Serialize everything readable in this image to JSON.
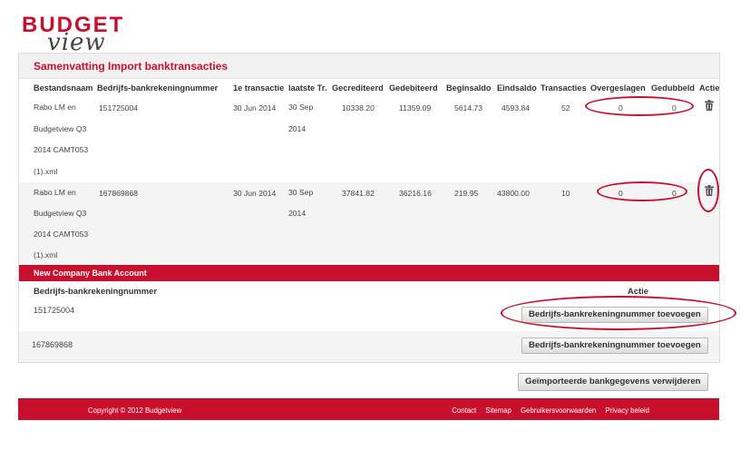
{
  "logo": {
    "line1": "BUDGET",
    "line2": "view"
  },
  "panel_title": "Samenvatting Import banktransacties",
  "columns": {
    "bestandsnaam": "Bestandsnaam",
    "rekening": "Bedrijfs-bankrekeningnummer",
    "eerste": "1e transactie",
    "laatste": "laatste Tr.",
    "gecrediteerd": "Gecrediteerd",
    "gedebiteerd": "Gedebiteerd",
    "beginsaldo": "Beginsaldo",
    "eindsaldo": "Eindsaldo",
    "transacties": "Transacties",
    "overgeslagen": "Overgeslagen",
    "gedubbeld": "Gedubbeld",
    "actie": "Actie"
  },
  "rows": [
    {
      "file_lines": [
        "Rabo LM en",
        "Budgetview Q3",
        "2014 CAMT053",
        "(1).xml"
      ],
      "rekening": "151725004",
      "eerste": "30 Jun 2014",
      "laatste_lines": [
        "30 Sep",
        "2014"
      ],
      "gecrediteerd": "10338.20",
      "gedebiteerd": "11359.09",
      "beginsaldo": "5614.73",
      "eindsaldo": "4593.84",
      "transacties": "52",
      "overgeslagen": "0",
      "gedubbeld": "0",
      "action_icon": "trash-icon"
    },
    {
      "file_lines": [
        "Rabo LM en",
        "Budgetview Q3",
        "2014 CAMT053",
        "(1).xml"
      ],
      "rekening": "167869868",
      "eerste": "30 Jun 2014",
      "laatste_lines": [
        "30 Sep",
        "2014"
      ],
      "gecrediteerd": "37841.82",
      "gedebiteerd": "36216.16",
      "beginsaldo": "219.95",
      "eindsaldo": "43800.00",
      "transacties": "10",
      "overgeslagen": "0",
      "gedubbeld": "0",
      "action_icon": "trash-icon"
    }
  ],
  "new_account": {
    "section_title": "New Company Bank Account",
    "col_rekening": "Bedrijfs-bankrekeningnummer",
    "col_actie": "Actie",
    "accounts": [
      {
        "number": "151725004",
        "button": "Bedrijfs-bankrekeningnummer toevoegen"
      },
      {
        "number": "167869868",
        "button": "Bedrijfs-bankrekeningnummer toevoegen"
      }
    ]
  },
  "delete_button": "Geïmporteerde bankgegevens verwijderen",
  "footer": {
    "copyright": "Copyright © 2012 Budgetview",
    "links": [
      "Contact",
      "Sitemap",
      "Gebruikersvoorwaarden",
      "Privacy beleid"
    ]
  },
  "colors": {
    "brand_red": "#c8102e",
    "highlight_circle": "#c8102e"
  }
}
